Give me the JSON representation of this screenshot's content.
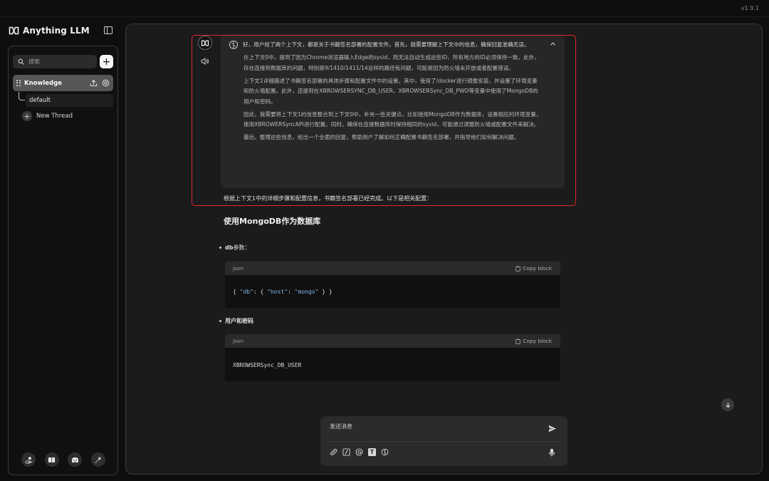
{
  "app": {
    "version": "v1.9.1",
    "brand_name": "Anything LLM"
  },
  "sidebar": {
    "search_placeholder": "搜索",
    "workspace": {
      "name": "Knowledge"
    },
    "thread_default": "default",
    "new_thread_label": "New Thread",
    "footer_icons": [
      "community-hub-icon",
      "docs-book-icon",
      "discord-icon",
      "wrench-settings-icon"
    ]
  },
  "chat": {
    "thought_paragraphs": [
      "好，用户给了两个上下文，都是关于书籍签名部署的配置文件。首先，我需要理解上下文中的信息，确保回复准确无误。",
      "在上下文0中，提到了因为Chrome浏览器输入Edge的sysid，而无法自动生成这些ID，所有地方的ID必须保持一致。此外，存在连接到数据库的问题，特别是9/1410/1411/14这样的路径有问题，可能是因为防火墙未开放或者配置错误。",
      "上下文1详细描述了书籍签名部署的具体步骤和配置文件中的设置。其中，使用了/docker进行镜像安装，并设置了环境变量和防火墙配置。此外，还提到在XBROWSERSYNC_DB_USER、XBROWSERSync_DB_PWD等变量中使用了MongoDB的用户和密码。",
      "因此，我需要将上下文1的信息整合到上下文0中，补充一些关键点，比如使用MongoDB作为数据库，设置相应的环境变量，使用XBROWERSyncAPI进行配置。同时，确保在连接数据库时保持相同的sysid，可能通过调整防火墙或配置文件来解决。",
      "最后，整理这些信息，给出一个全面的回复，帮助用户了解如何正确配置书籍签名部署，并指导他们如何解决问题。"
    ],
    "answer_intro": "根据上下文1中的详细步骤和配置信息，书籍签名部署已经完成。以下是相关配置：",
    "heading": "使用MongoDB作为数据库",
    "bullet1": {
      "bold": "db",
      "rest": "参数："
    },
    "bullet2": {
      "bold": "用户和密码",
      "rest": ""
    },
    "code1": {
      "lang": "json",
      "copy_label": "Copy block",
      "open": "{ ",
      "key": "\"db\"",
      "colon1": ": { ",
      "key2": "\"host\"",
      "colon2": ": ",
      "val": "\"mongo\"",
      "close": " } }"
    },
    "code2": {
      "lang": "json",
      "copy_label": "Copy block",
      "content": "XBROWSERSync_DB_USER"
    }
  },
  "composer": {
    "placeholder": "发送消息",
    "tools": [
      "attachment-icon",
      "slash-command-icon",
      "at-mention-icon",
      "text-size-icon",
      "agent-brain-icon"
    ]
  }
}
